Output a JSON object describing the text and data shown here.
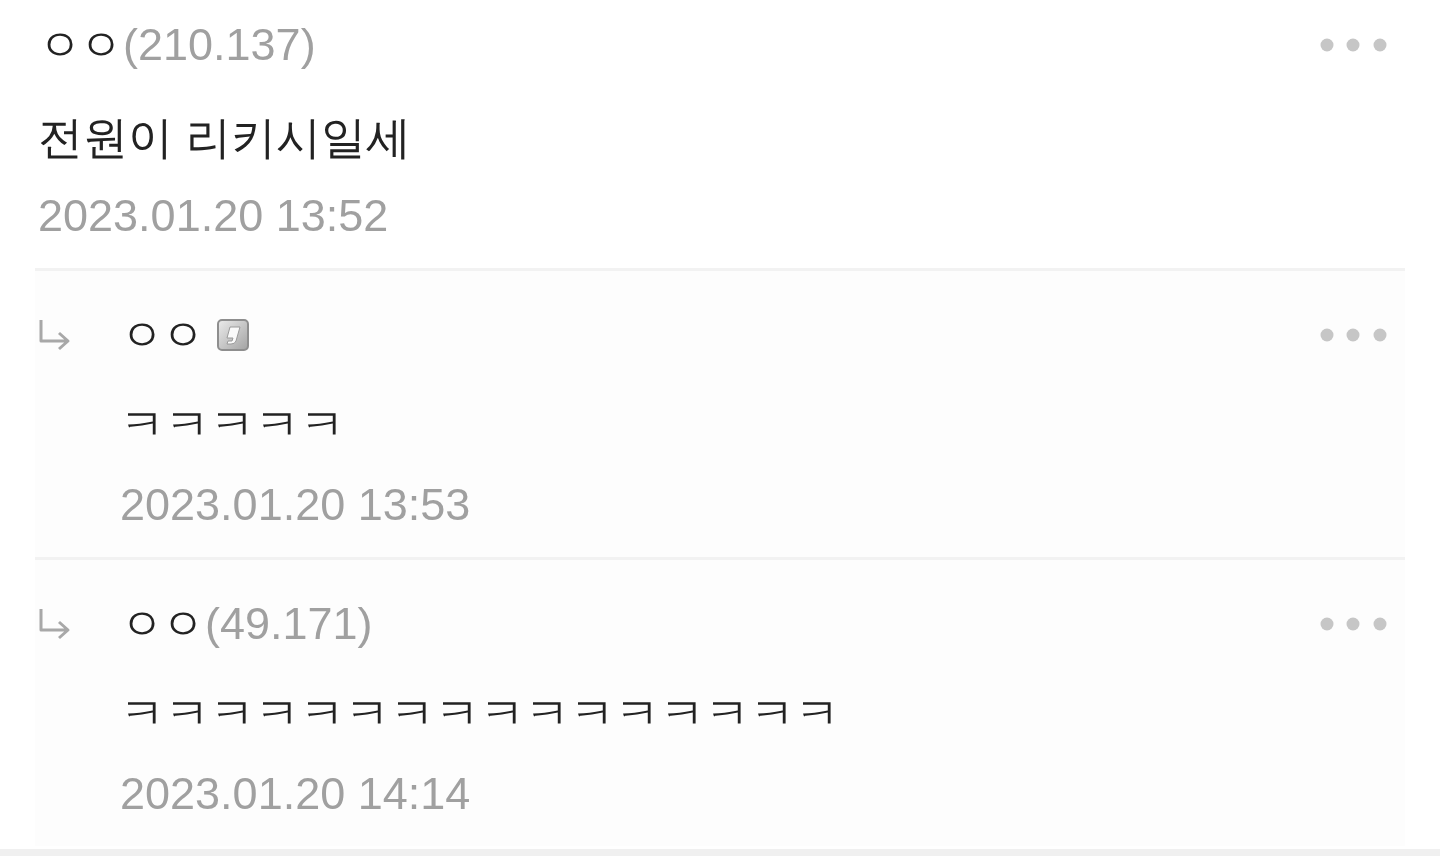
{
  "comments": [
    {
      "kind": "comment",
      "author": "ㅇㅇ",
      "ip": "(210.137)",
      "badge": false,
      "text": "전원이 리키시일세",
      "date": "2023.01.20 13:52"
    },
    {
      "kind": "reply",
      "author": "ㅇㅇ",
      "badge": true,
      "text": "ㅋㅋㅋㅋㅋ",
      "date": "2023.01.20 13:53"
    },
    {
      "kind": "reply",
      "author": "ㅇㅇ",
      "ip": "(49.171)",
      "badge": false,
      "text": "ㅋㅋㅋㅋㅋㅋㅋㅋㅋㅋㅋㅋㅋㅋㅋㅋ",
      "date": "2023.01.20 14:14"
    }
  ]
}
